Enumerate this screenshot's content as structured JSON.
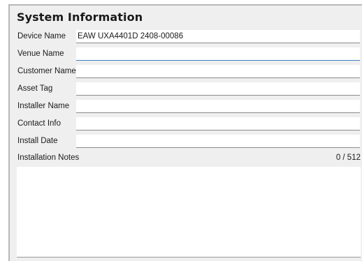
{
  "section": {
    "title": "System Information"
  },
  "fields": [
    {
      "label": "Device Name",
      "value": "EAW UXA4401D 2408-00086",
      "placeholder": ""
    },
    {
      "label": "Venue Name",
      "value": "",
      "placeholder": ""
    },
    {
      "label": "Customer Name",
      "value": "",
      "placeholder": ""
    },
    {
      "label": "Asset Tag",
      "value": "",
      "placeholder": ""
    },
    {
      "label": "Installer Name",
      "value": "",
      "placeholder": ""
    },
    {
      "label": "Contact Info",
      "value": "",
      "placeholder": ""
    },
    {
      "label": "Install Date",
      "value": "",
      "placeholder": ""
    }
  ],
  "notes": {
    "label": "Installation Notes",
    "counter": "0 / 512",
    "value": ""
  },
  "colors": {
    "panel_bg": "#efefef",
    "focus_accent": "#3b7fc4"
  }
}
